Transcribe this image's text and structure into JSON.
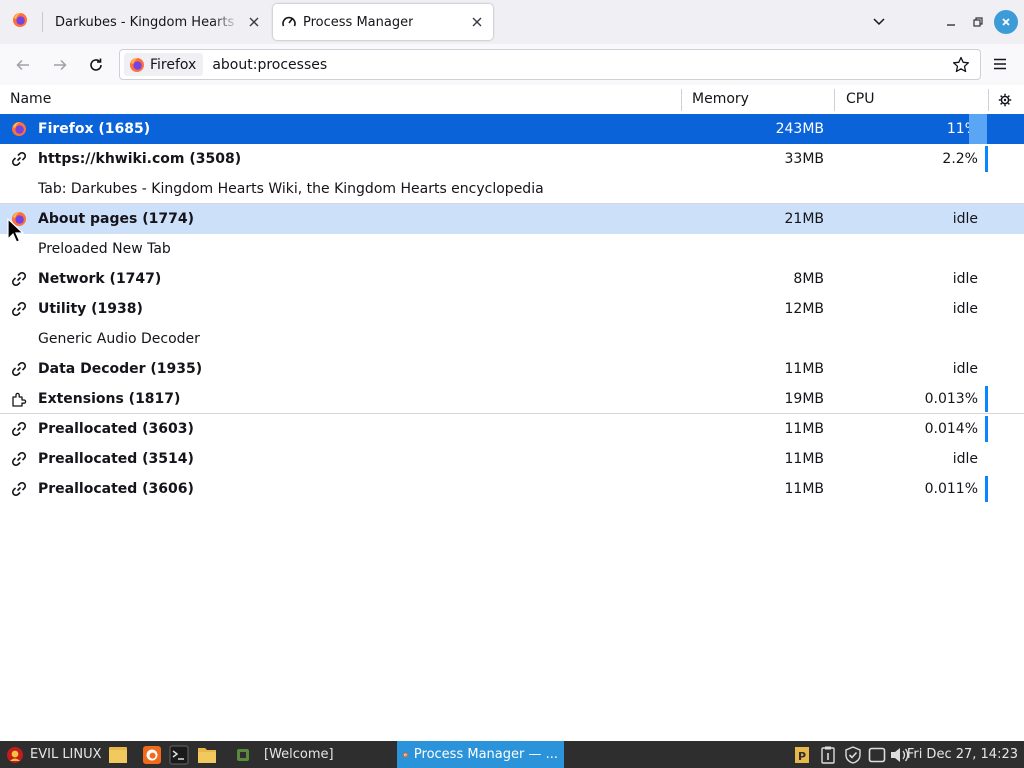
{
  "tabs": [
    {
      "title": "Darkubes - Kingdom Hearts Wiki, the Kingdom Hearts encyclopedia",
      "active": false
    },
    {
      "title": "Process Manager",
      "active": true
    }
  ],
  "navbar": {
    "identity_label": "Firefox",
    "url": "about:processes"
  },
  "table": {
    "headers": {
      "name": "Name",
      "memory": "Memory",
      "cpu": "CPU"
    },
    "rows": [
      {
        "kind": "process",
        "icon": "firefox-icon",
        "name": "Firefox (1685)",
        "memory": "243MB",
        "cpu": "11%",
        "state": "selected",
        "cpu_fraction": 0.11
      },
      {
        "kind": "process",
        "icon": "process-icon",
        "name": "https://khwiki.com (3508)",
        "memory": "33MB",
        "cpu": "2.2%",
        "cpu_fraction": 0.022
      },
      {
        "kind": "sub",
        "name": "Tab: Darkubes - Kingdom Hearts Wiki, the Kingdom Hearts encyclopedia",
        "memory": "",
        "cpu": ""
      },
      {
        "kind": "process",
        "icon": "firefox-icon",
        "name": "About pages (1774)",
        "memory": "21MB",
        "cpu": "idle",
        "state": "hover",
        "sep_top": true
      },
      {
        "kind": "sub",
        "name": "Preloaded New Tab",
        "memory": "",
        "cpu": ""
      },
      {
        "kind": "process",
        "icon": "process-icon",
        "name": "Network (1747)",
        "memory": "8MB",
        "cpu": "idle"
      },
      {
        "kind": "process",
        "icon": "process-icon",
        "name": "Utility (1938)",
        "memory": "12MB",
        "cpu": "idle"
      },
      {
        "kind": "sub",
        "name": "Generic Audio Decoder",
        "memory": "",
        "cpu": ""
      },
      {
        "kind": "process",
        "icon": "process-icon",
        "name": "Data Decoder (1935)",
        "memory": "11MB",
        "cpu": "idle"
      },
      {
        "kind": "process",
        "icon": "extension-icon",
        "name": "Extensions (1817)",
        "memory": "19MB",
        "cpu": "0.013%",
        "cpu_fraction": 0.00013
      },
      {
        "kind": "process",
        "icon": "process-icon",
        "name": "Preallocated (3603)",
        "memory": "11MB",
        "cpu": "0.014%",
        "cpu_fraction": 0.00014,
        "sep_top": true
      },
      {
        "kind": "process",
        "icon": "process-icon",
        "name": "Preallocated (3514)",
        "memory": "11MB",
        "cpu": "idle"
      },
      {
        "kind": "process",
        "icon": "process-icon",
        "name": "Preallocated (3606)",
        "memory": "11MB",
        "cpu": "0.011%",
        "cpu_fraction": 0.00011
      }
    ]
  },
  "taskbar": {
    "start_label": "EVIL LINUX",
    "windows": [
      {
        "label": "[Welcome]",
        "active": false
      },
      {
        "label": "Process Manager — ...",
        "active": true
      }
    ],
    "clock": "Fri Dec 27, 14:23"
  },
  "colors": {
    "selected_row": "#0a63d8",
    "hover_row": "#cde0fa",
    "cpu_bar": "#0a84ff",
    "taskbar_active": "#2a93d9"
  }
}
